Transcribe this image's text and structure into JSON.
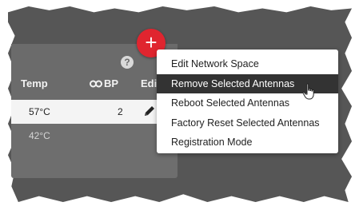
{
  "table": {
    "columns": {
      "temp": "Temp",
      "bp": "BP",
      "edit": "Edi"
    },
    "rows": [
      {
        "temp": "57°C",
        "bp": "2",
        "selected": true
      },
      {
        "temp": "42°C",
        "bp": "",
        "selected": false
      }
    ]
  },
  "add_button": {
    "label": "+"
  },
  "help_icon": {
    "label": "?"
  },
  "menu": {
    "items": [
      {
        "label": "Edit Network Space"
      },
      {
        "label": "Remove Selected Antennas",
        "highlighted": true
      },
      {
        "label": "Reboot Selected Antennas"
      },
      {
        "label": "Factory Reset Selected Antennas"
      },
      {
        "label": "Registration Mode"
      }
    ]
  },
  "colors": {
    "accent_red": "#e0252f",
    "highlight": "#333333",
    "backdrop": "#565656"
  },
  "icons": [
    "help-icon",
    "link-icon",
    "pencil-icon",
    "plus-icon",
    "hand-cursor-icon"
  ]
}
